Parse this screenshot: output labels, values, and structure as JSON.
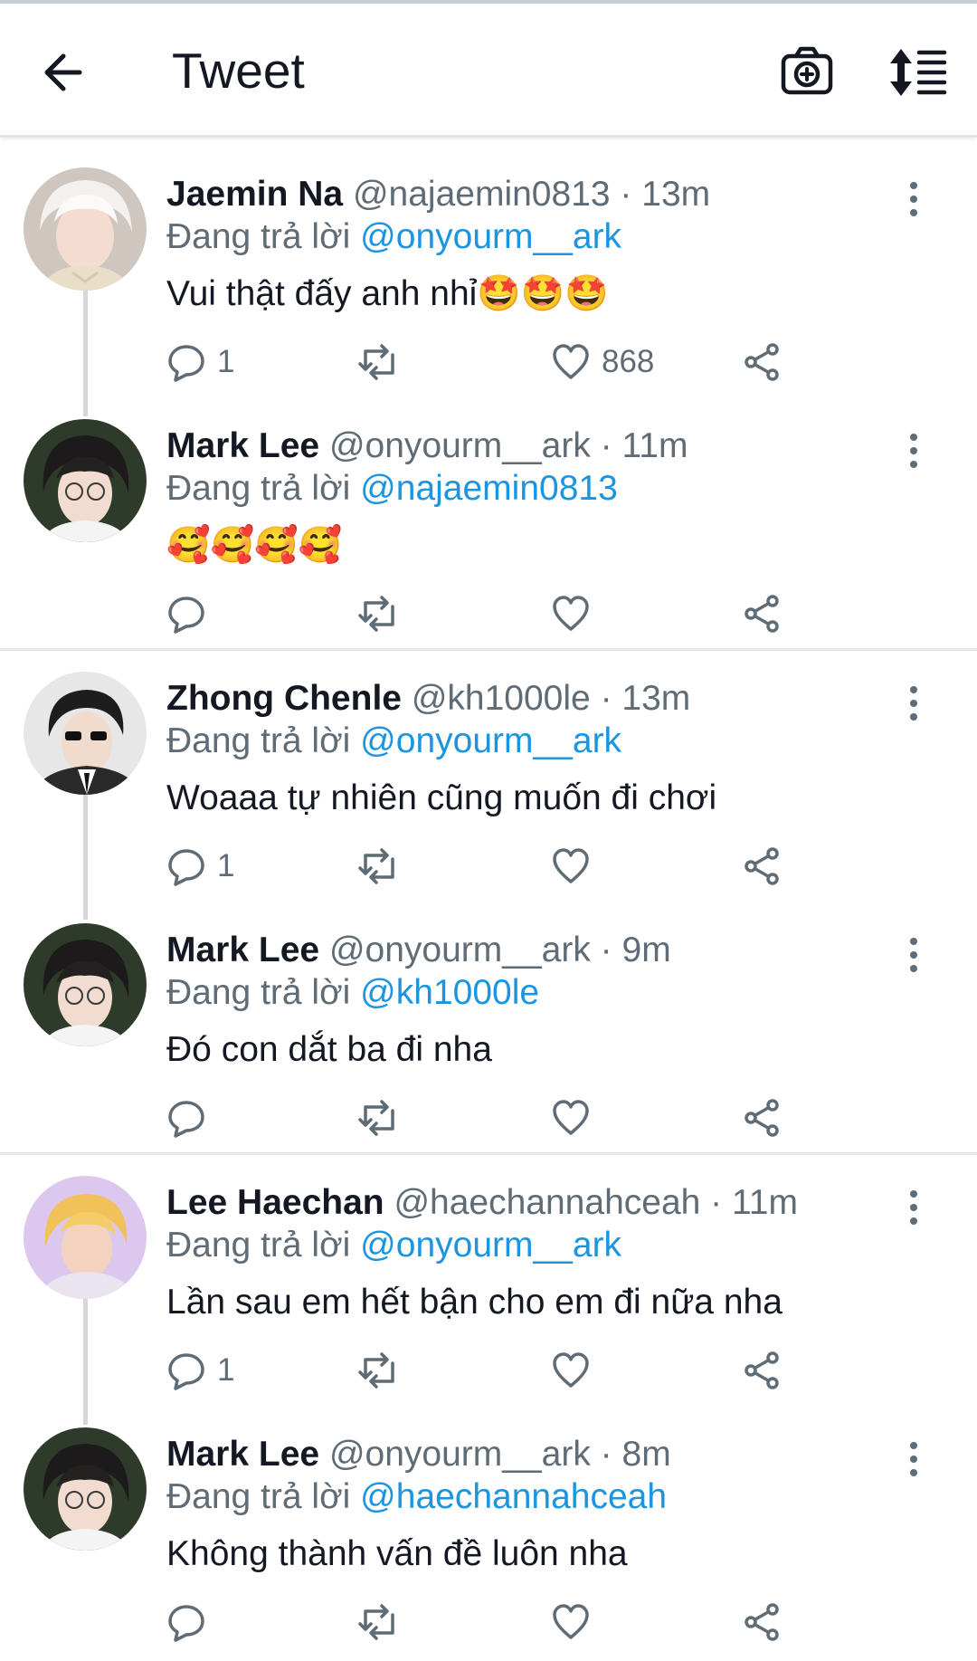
{
  "header": {
    "title": "Tweet",
    "back_icon": "arrow-left-icon",
    "camera_icon": "camera-plus-icon",
    "sort_icon": "sort-icon"
  },
  "reply_prefix": "Đang trả lời",
  "colors": {
    "mention": "#1b95e0",
    "secondary": "#5f6b75",
    "primary": "#141823"
  },
  "tweets": [
    {
      "name": "Jaemin Na",
      "handle": "@najaemin0813",
      "dot": "·",
      "time": "13m",
      "reply_to": "@onyourm__ark",
      "text": "Vui thật đấy anh nhỉ🤩🤩🤩",
      "reply_count": "1",
      "like_count": "868"
    },
    {
      "name": "Mark Lee",
      "handle": "@onyourm__ark",
      "dot": "·",
      "time": "11m",
      "reply_to": "@najaemin0813",
      "text": "🥰🥰🥰🥰",
      "reply_count": "",
      "like_count": ""
    },
    {
      "name": "Zhong Chenle",
      "handle": "@kh1000le",
      "dot": "·",
      "time": "13m",
      "reply_to": "@onyourm__ark",
      "text": "Woaaa tự nhiên cũng muốn đi chơi",
      "reply_count": "1",
      "like_count": ""
    },
    {
      "name": "Mark Lee",
      "handle": "@onyourm__ark",
      "dot": "·",
      "time": "9m",
      "reply_to": "@kh1000le",
      "text": "Đó con dắt ba đi nha",
      "reply_count": "",
      "like_count": ""
    },
    {
      "name": "Lee Haechan",
      "handle": "@haechannahceah",
      "dot": "·",
      "time": "11m",
      "reply_to": "@onyourm__ark",
      "text": "Lần sau em hết bận cho em đi nữa nha",
      "reply_count": "1",
      "like_count": ""
    },
    {
      "name": "Mark Lee",
      "handle": "@onyourm__ark",
      "dot": "·",
      "time": "8m",
      "reply_to": "@haechannahceah",
      "text": "Không thành vấn đề luôn nha",
      "reply_count": "",
      "like_count": ""
    }
  ]
}
